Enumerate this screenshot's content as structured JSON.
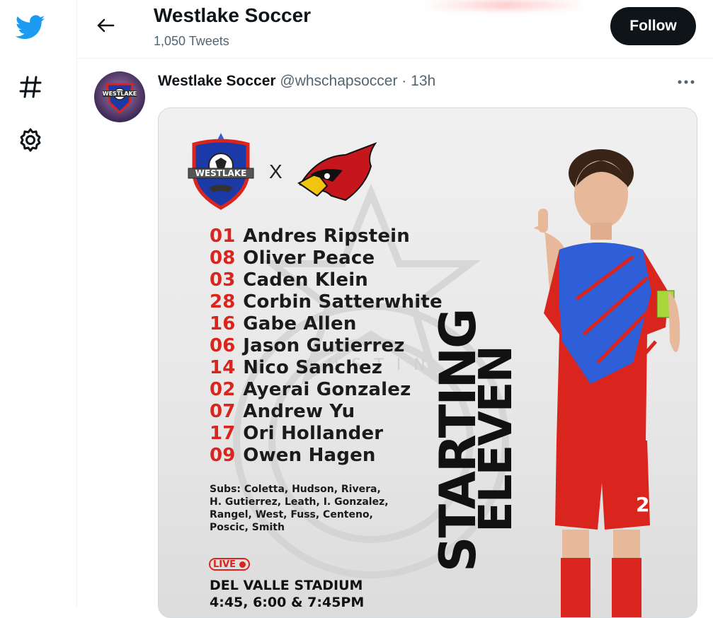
{
  "nav": {
    "items": [
      {
        "icon": "twitter-bird-icon",
        "color": "#1d9bf0"
      },
      {
        "icon": "hashtag-icon"
      },
      {
        "icon": "gear-icon"
      }
    ]
  },
  "header": {
    "title": "Westlake Soccer",
    "subtitle": "1,050 Tweets",
    "follow_label": "Follow"
  },
  "tweet": {
    "author_name": "Westlake Soccer",
    "handle": "@whschapsoccer",
    "separator": "·",
    "time": "13h",
    "avatar_text": "WESTLAKE"
  },
  "graphic": {
    "team_logo_text": "WESTLAKE",
    "vs_label": "X",
    "roster": [
      {
        "number": "01",
        "name": "Andres Ripstein"
      },
      {
        "number": "08",
        "name": "Oliver Peace"
      },
      {
        "number": "03",
        "name": "Caden Klein"
      },
      {
        "number": "28",
        "name": "Corbin Satterwhite"
      },
      {
        "number": "16",
        "name": "Gabe Allen"
      },
      {
        "number": "06",
        "name": "Jason Gutierrez"
      },
      {
        "number": "14",
        "name": "Nico Sanchez"
      },
      {
        "number": "02",
        "name": "Ayerai Gonzalez"
      },
      {
        "number": "07",
        "name": "Andrew Yu"
      },
      {
        "number": "17",
        "name": "Ori Hollander"
      },
      {
        "number": "09",
        "name": "Owen Hagen"
      }
    ],
    "subs": "Subs: Coletta, Hudson, Rivera, H. Gutierrez, Leath, I. Gonzalez, Rangel, West, Fuss, Centeno, Poscic, Smith",
    "live_label": "LIVE",
    "venue": "DEL VALLE STADIUM",
    "times": "4:45, 6:00 & 7:45PM",
    "vertical_title_1": "STARTING",
    "vertical_title_2": "ELEVEN",
    "watermark_text": "AUSTIN",
    "jersey_number": "2",
    "accent_red": "#d9251d",
    "jersey_blue": "#2e5fd9"
  }
}
